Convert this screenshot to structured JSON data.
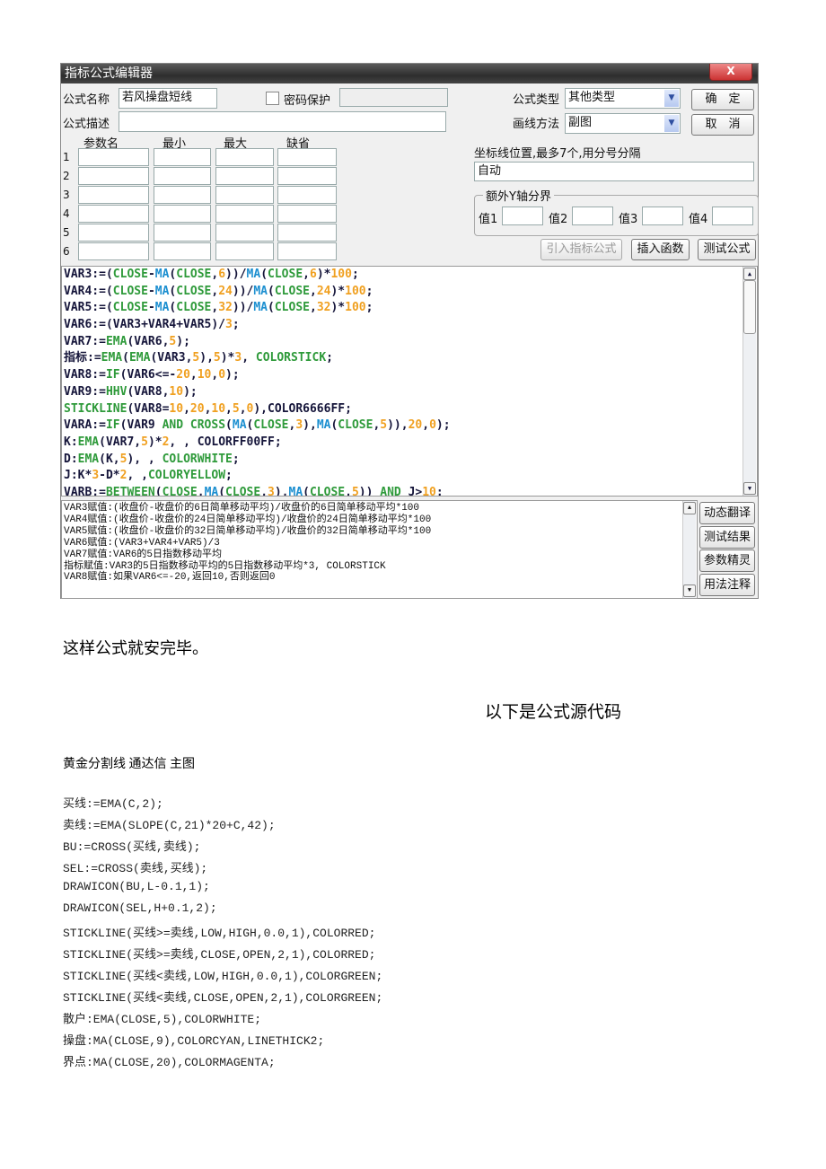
{
  "dialog": {
    "title": "指标公式编辑器",
    "close_label": "X",
    "name_label": "公式名称",
    "name_value": "若风操盘短线",
    "password_label": "密码保护",
    "password_checked": false,
    "password_value": "",
    "type_label": "公式类型",
    "type_value": "其他类型",
    "desc_label": "公式描述",
    "desc_value": "",
    "draw_label": "画线方法",
    "draw_value": "副图",
    "ok_label": "确　定",
    "cancel_label": "取　消",
    "param_headers": [
      "参数名",
      "最小",
      "最大",
      "缺省"
    ],
    "param_rows": [
      "1",
      "2",
      "3",
      "4",
      "5",
      "6"
    ],
    "axis_label": "坐标线位置,最多7个,用分号分隔",
    "axis_value": "自动",
    "yaxis_group": "额外Y轴分界",
    "yaxis_values": [
      {
        "label": "值1",
        "value": ""
      },
      {
        "label": "值2",
        "value": ""
      },
      {
        "label": "值3",
        "value": ""
      },
      {
        "label": "值4",
        "value": ""
      }
    ],
    "import_button": "引入指标公式",
    "insert_button": "插入函数",
    "test_button": "测试公式",
    "side_buttons": [
      "动态翻译",
      "测试结果",
      "参数精灵",
      "用法注释"
    ],
    "code_lines": [
      [
        [
          "VAR3:=(",
          "d"
        ],
        [
          "CLOSE",
          "g"
        ],
        [
          "-",
          "d"
        ],
        [
          "MA",
          "b"
        ],
        [
          "(",
          "d"
        ],
        [
          "CLOSE",
          "g"
        ],
        [
          ",",
          "d"
        ],
        [
          "6",
          "o"
        ],
        [
          "))/",
          "d"
        ],
        [
          "MA",
          "b"
        ],
        [
          "(",
          "d"
        ],
        [
          "CLOSE",
          "g"
        ],
        [
          ",",
          "d"
        ],
        [
          "6",
          "o"
        ],
        [
          ")*",
          "d"
        ],
        [
          "100",
          "o"
        ],
        [
          ";",
          "d"
        ]
      ],
      [
        [
          "VAR4:=(",
          "d"
        ],
        [
          "CLOSE",
          "g"
        ],
        [
          "-",
          "d"
        ],
        [
          "MA",
          "b"
        ],
        [
          "(",
          "d"
        ],
        [
          "CLOSE",
          "g"
        ],
        [
          ",",
          "d"
        ],
        [
          "24",
          "o"
        ],
        [
          "))/",
          "d"
        ],
        [
          "MA",
          "b"
        ],
        [
          "(",
          "d"
        ],
        [
          "CLOSE",
          "g"
        ],
        [
          ",",
          "d"
        ],
        [
          "24",
          "o"
        ],
        [
          ")*",
          "d"
        ],
        [
          "100",
          "o"
        ],
        [
          ";",
          "d"
        ]
      ],
      [
        [
          "VAR5:=(",
          "d"
        ],
        [
          "CLOSE",
          "g"
        ],
        [
          "-",
          "d"
        ],
        [
          "MA",
          "b"
        ],
        [
          "(",
          "d"
        ],
        [
          "CLOSE",
          "g"
        ],
        [
          ",",
          "d"
        ],
        [
          "32",
          "o"
        ],
        [
          "))/",
          "d"
        ],
        [
          "MA",
          "b"
        ],
        [
          "(",
          "d"
        ],
        [
          "CLOSE",
          "g"
        ],
        [
          ",",
          "d"
        ],
        [
          "32",
          "o"
        ],
        [
          ")*",
          "d"
        ],
        [
          "100",
          "o"
        ],
        [
          ";",
          "d"
        ]
      ],
      [
        [
          "VAR6:=(VAR3+VAR4+VAR5)/",
          "d"
        ],
        [
          "3",
          "o"
        ],
        [
          ";",
          "d"
        ]
      ],
      [
        [
          "VAR7:=",
          "d"
        ],
        [
          "EMA",
          "g"
        ],
        [
          "(VAR6,",
          "d"
        ],
        [
          "5",
          "o"
        ],
        [
          ");",
          "d"
        ]
      ],
      [
        [
          "指标:=",
          "d"
        ],
        [
          "EMA",
          "g"
        ],
        [
          "(",
          "d"
        ],
        [
          "EMA",
          "g"
        ],
        [
          "(VAR3,",
          "d"
        ],
        [
          "5",
          "o"
        ],
        [
          "),",
          "d"
        ],
        [
          "5",
          "o"
        ],
        [
          ")*",
          "d"
        ],
        [
          "3",
          "o"
        ],
        [
          ", ",
          "d"
        ],
        [
          "COLORSTICK",
          "g"
        ],
        [
          ";",
          "d"
        ]
      ],
      [
        [
          "VAR8:=",
          "d"
        ],
        [
          "IF",
          "g"
        ],
        [
          "(VAR6<=-",
          "d"
        ],
        [
          "20",
          "o"
        ],
        [
          ",",
          "d"
        ],
        [
          "10",
          "o"
        ],
        [
          ",",
          "d"
        ],
        [
          "0",
          "o"
        ],
        [
          ");",
          "d"
        ]
      ],
      [
        [
          "VAR9:=",
          "d"
        ],
        [
          "HHV",
          "g"
        ],
        [
          "(VAR8,",
          "d"
        ],
        [
          "10",
          "o"
        ],
        [
          ");",
          "d"
        ]
      ],
      [
        [
          "STICKLINE",
          "g"
        ],
        [
          "(VAR8=",
          "d"
        ],
        [
          "10",
          "o"
        ],
        [
          ",",
          "d"
        ],
        [
          "20",
          "o"
        ],
        [
          ",",
          "d"
        ],
        [
          "10",
          "o"
        ],
        [
          ",",
          "d"
        ],
        [
          "5",
          "o"
        ],
        [
          ",",
          "d"
        ],
        [
          "0",
          "o"
        ],
        [
          "),COLOR6666FF;",
          "d"
        ]
      ],
      [
        [
          "VARA:=",
          "d"
        ],
        [
          "IF",
          "g"
        ],
        [
          "(VAR9 ",
          "d"
        ],
        [
          "AND",
          "g"
        ],
        [
          " ",
          "d"
        ],
        [
          "CROSS",
          "g"
        ],
        [
          "(",
          "d"
        ],
        [
          "MA",
          "b"
        ],
        [
          "(",
          "d"
        ],
        [
          "CLOSE",
          "g"
        ],
        [
          ",",
          "d"
        ],
        [
          "3",
          "o"
        ],
        [
          "),",
          "d"
        ],
        [
          "MA",
          "b"
        ],
        [
          "(",
          "d"
        ],
        [
          "CLOSE",
          "g"
        ],
        [
          ",",
          "d"
        ],
        [
          "5",
          "o"
        ],
        [
          ")),",
          "d"
        ],
        [
          "20",
          "o"
        ],
        [
          ",",
          "d"
        ],
        [
          "0",
          "o"
        ],
        [
          ");",
          "d"
        ]
      ],
      [
        [
          "K:",
          "d"
        ],
        [
          "EMA",
          "g"
        ],
        [
          "(VAR7,",
          "d"
        ],
        [
          "5",
          "o"
        ],
        [
          ")*",
          "d"
        ],
        [
          "2",
          "o"
        ],
        [
          ", , COLORFF00FF;",
          "d"
        ]
      ],
      [
        [
          "D:",
          "d"
        ],
        [
          "EMA",
          "g"
        ],
        [
          "(K,",
          "d"
        ],
        [
          "5",
          "o"
        ],
        [
          "), , ",
          "d"
        ],
        [
          "COLORWHITE",
          "g"
        ],
        [
          ";",
          "d"
        ]
      ],
      [
        [
          "J:K*",
          "d"
        ],
        [
          "3",
          "o"
        ],
        [
          "-D*",
          "d"
        ],
        [
          "2",
          "o"
        ],
        [
          ", ,",
          "d"
        ],
        [
          "COLORYELLOW",
          "g"
        ],
        [
          ";",
          "d"
        ]
      ],
      [
        [
          "VARB:=",
          "d"
        ],
        [
          "BETWEEN",
          "g"
        ],
        [
          "(",
          "d"
        ],
        [
          "CLOSE",
          "g"
        ],
        [
          ",",
          "d"
        ],
        [
          "MA",
          "b"
        ],
        [
          "(",
          "d"
        ],
        [
          "CLOSE",
          "g"
        ],
        [
          ",",
          "d"
        ],
        [
          "3",
          "o"
        ],
        [
          "),",
          "d"
        ],
        [
          "MA",
          "b"
        ],
        [
          "(",
          "d"
        ],
        [
          "CLOSE",
          "g"
        ],
        [
          ",",
          "d"
        ],
        [
          "5",
          "o"
        ],
        [
          ")) ",
          "d"
        ],
        [
          "AND",
          "g"
        ],
        [
          " J>",
          "d"
        ],
        [
          "10",
          "o"
        ],
        [
          ";",
          "d"
        ]
      ]
    ],
    "explain_lines": [
      "VAR3赋值:(收盘价-收盘价的6日简单移动平均)/收盘价的6日简单移动平均*100",
      "VAR4赋值:(收盘价-收盘价的24日简单移动平均)/收盘价的24日简单移动平均*100",
      "VAR5赋值:(收盘价-收盘价的32日简单移动平均)/收盘价的32日简单移动平均*100",
      "VAR6赋值:(VAR3+VAR4+VAR5)/3",
      "VAR7赋值:VAR6的5日指数移动平均",
      "指标赋值:VAR3的5日指数移动平均的5日指数移动平均*3, COLORSTICK",
      "VAR8赋值:如果VAR6<=-20,返回10,否则返回0"
    ],
    "colors": {
      "keyword": "#2e9a3a",
      "function": "#1c8fd0",
      "number": "#f0a020",
      "text": "#15153a"
    }
  },
  "doc": {
    "done_text": "这样公式就安完毕。",
    "source_heading": "以下是公式源代码",
    "source_title": "黄金分割线 通达信 主图",
    "source_lines": [
      "买线:=EMA(C,2);",
      "卖线:=EMA(SLOPE(C,21)*20+C,42);",
      "BU:=CROSS(买线,卖线);",
      "SEL:=CROSS(卖线,买线);",
      "DRAWICON(BU,L-0.1,1);",
      "DRAWICON(SEL,H+0.1,2);",
      "STICKLINE(买线>=卖线,LOW,HIGH,0.0,1),COLORRED;",
      "STICKLINE(买线>=卖线,CLOSE,OPEN,2,1),COLORRED;",
      "STICKLINE(买线<卖线,LOW,HIGH,0.0,1),COLORGREEN;",
      "STICKLINE(买线<卖线,CLOSE,OPEN,2,1),COLORGREEN;",
      "散户:EMA(CLOSE,5),COLORWHITE;",
      "操盘:MA(CLOSE,9),COLORCYAN,LINETHICK2;",
      "界点:MA(CLOSE,20),COLORMAGENTA;"
    ]
  }
}
